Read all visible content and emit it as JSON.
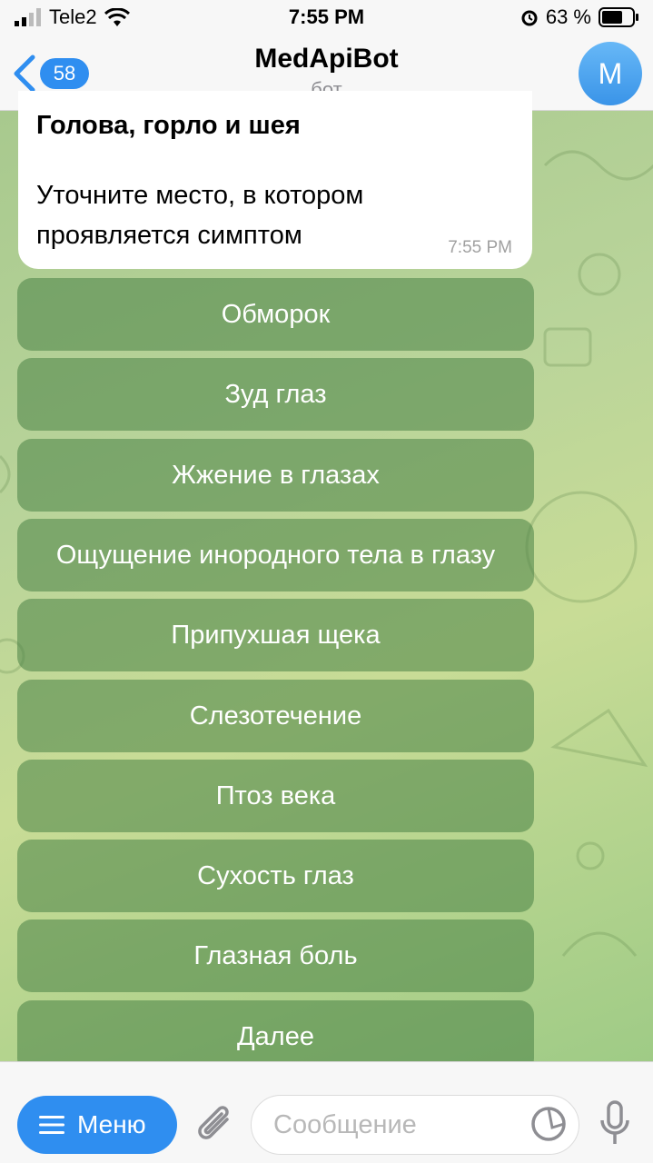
{
  "status_bar": {
    "carrier": "Tele2",
    "time": "7:55 PM",
    "battery": "63 %"
  },
  "header": {
    "back_count": "58",
    "title": "MedApiBot",
    "subtitle": "бот",
    "avatar_letter": "M"
  },
  "message": {
    "title": "Голова, горло и шея",
    "text": "Уточните место, в котором проявляется симптом",
    "time": "7:55 PM"
  },
  "keyboard": [
    "Обморок",
    "Зуд глаз",
    "Жжение в глазах",
    "Ощущение инородного тела в глазу",
    "Припухшая щека",
    "Слезотечение",
    "Птоз века",
    "Сухость глаз",
    "Глазная боль",
    "Далее"
  ],
  "input_bar": {
    "menu_label": "Меню",
    "placeholder": "Сообщение"
  },
  "colors": {
    "accent": "#2f8ef0",
    "keyboard_button": "#5f9a5c"
  }
}
